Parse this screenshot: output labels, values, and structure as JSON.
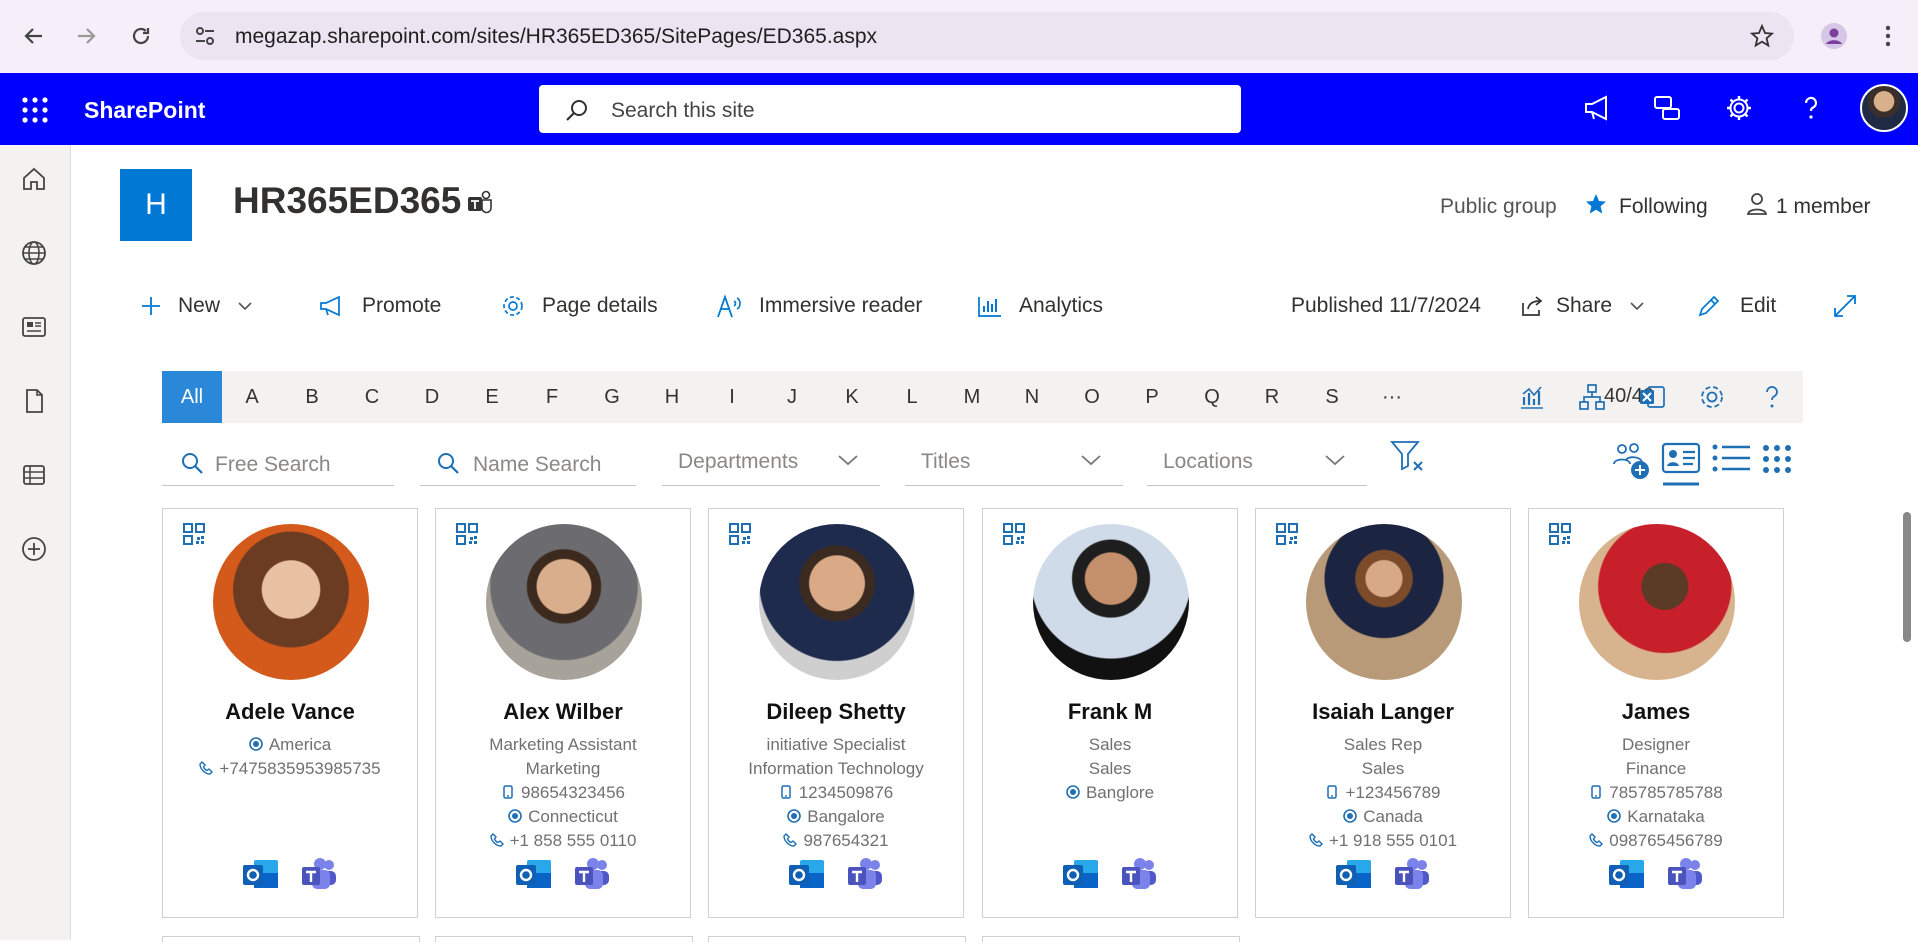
{
  "browser": {
    "url": "megazap.sharepoint.com/sites/HR365ED365/SitePages/ED365.aspx"
  },
  "suite": {
    "brand": "SharePoint",
    "search_placeholder": "Search this site"
  },
  "site": {
    "logo_letter": "H",
    "title": "HR365ED365",
    "group_type": "Public group",
    "following_label": "Following",
    "members_label": "1 member"
  },
  "commands": {
    "new": "New",
    "promote": "Promote",
    "page_details": "Page details",
    "immersive_reader": "Immersive reader",
    "analytics": "Analytics",
    "published": "Published 11/7/2024",
    "share": "Share",
    "edit": "Edit"
  },
  "alphabet": {
    "items": [
      "All",
      "A",
      "B",
      "C",
      "D",
      "E",
      "F",
      "G",
      "H",
      "I",
      "J",
      "K",
      "L",
      "M",
      "N",
      "O",
      "P",
      "Q",
      "R",
      "S",
      "···"
    ],
    "active": "All",
    "count": "40/40"
  },
  "filters": {
    "free_search": "Free Search",
    "name_search": "Name Search",
    "departments": "Departments",
    "titles": "Titles",
    "locations": "Locations"
  },
  "people": [
    {
      "name": "Adele Vance",
      "lines": [
        {
          "icon": "location",
          "text": "America"
        },
        {
          "icon": "phone",
          "text": "+7475835953985735"
        }
      ]
    },
    {
      "name": "Alex Wilber",
      "lines": [
        {
          "icon": "",
          "text": "Marketing Assistant"
        },
        {
          "icon": "",
          "text": "Marketing"
        },
        {
          "icon": "mobile",
          "text": "98654323456"
        },
        {
          "icon": "location",
          "text": "Connecticut"
        },
        {
          "icon": "phone",
          "text": "+1 858 555 0110"
        }
      ]
    },
    {
      "name": "Dileep Shetty",
      "lines": [
        {
          "icon": "",
          "text": "initiative Specialist"
        },
        {
          "icon": "",
          "text": "Information Technology"
        },
        {
          "icon": "mobile",
          "text": "1234509876"
        },
        {
          "icon": "location",
          "text": "Bangalore"
        },
        {
          "icon": "phone",
          "text": "987654321"
        }
      ]
    },
    {
      "name": "Frank M",
      "lines": [
        {
          "icon": "",
          "text": "Sales"
        },
        {
          "icon": "",
          "text": "Sales"
        },
        {
          "icon": "location",
          "text": "Banglore"
        }
      ]
    },
    {
      "name": "Isaiah Langer",
      "lines": [
        {
          "icon": "",
          "text": "Sales Rep"
        },
        {
          "icon": "",
          "text": "Sales"
        },
        {
          "icon": "mobile",
          "text": "+123456789"
        },
        {
          "icon": "location",
          "text": "Canada"
        },
        {
          "icon": "phone",
          "text": "+1 918 555 0101"
        }
      ]
    },
    {
      "name": "James",
      "lines": [
        {
          "icon": "",
          "text": "Designer"
        },
        {
          "icon": "",
          "text": "Finance"
        },
        {
          "icon": "mobile",
          "text": "785785785788"
        },
        {
          "icon": "location",
          "text": "Karnataka"
        },
        {
          "icon": "phone",
          "text": "098765456789"
        }
      ]
    }
  ],
  "colors": {
    "suite_bar": "#0000ff",
    "accent": "#0078d4",
    "alpha_active": "#2b88d8"
  }
}
